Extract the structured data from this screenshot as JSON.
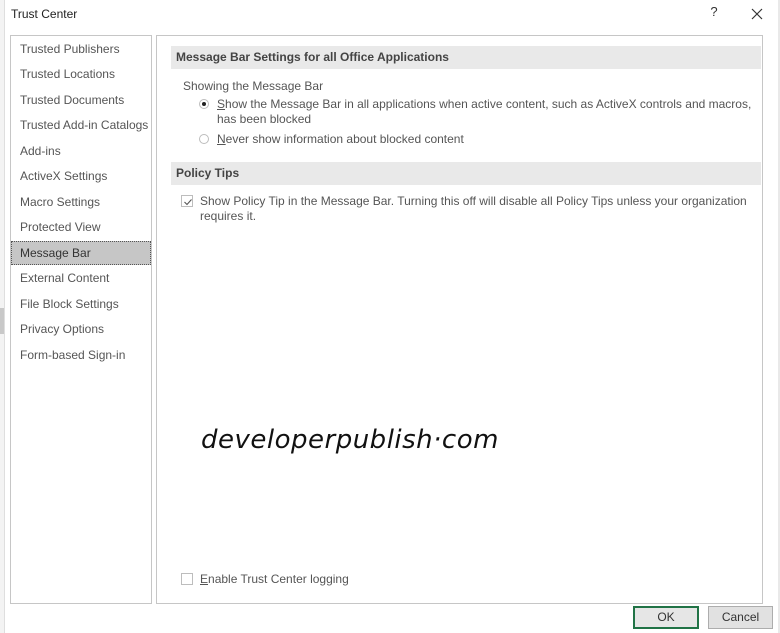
{
  "window": {
    "title": "Trust Center",
    "help_label": "?",
    "close_icon": "close-icon"
  },
  "sidebar": {
    "items": [
      {
        "label": "Trusted Publishers",
        "selected": false
      },
      {
        "label": "Trusted Locations",
        "selected": false
      },
      {
        "label": "Trusted Documents",
        "selected": false
      },
      {
        "label": "Trusted Add-in Catalogs",
        "selected": false
      },
      {
        "label": "Add-ins",
        "selected": false
      },
      {
        "label": "ActiveX Settings",
        "selected": false
      },
      {
        "label": "Macro Settings",
        "selected": false
      },
      {
        "label": "Protected View",
        "selected": false
      },
      {
        "label": "Message Bar",
        "selected": true
      },
      {
        "label": "External Content",
        "selected": false
      },
      {
        "label": "File Block Settings",
        "selected": false
      },
      {
        "label": "Privacy Options",
        "selected": false
      },
      {
        "label": "Form-based Sign-in",
        "selected": false
      }
    ]
  },
  "main": {
    "message_bar_section": {
      "header": "Message Bar Settings for all Office Applications",
      "group_label": "Showing the Message Bar",
      "options": [
        {
          "accel": "S",
          "rest": "how the Message Bar in all applications when active content, such as ActiveX controls and macros, has been blocked",
          "checked": true
        },
        {
          "accel": "N",
          "rest": "ever show information about blocked content",
          "checked": false
        }
      ]
    },
    "policy_tips_section": {
      "header": "Policy Tips",
      "checkbox": {
        "label": "Show Policy Tip in the Message Bar. Turning this off will disable all Policy Tips unless your organization requires it.",
        "checked": true
      }
    },
    "watermark": "developerpublish·com",
    "logging": {
      "accel": "E",
      "rest": "nable Trust Center logging",
      "checked": false
    }
  },
  "footer": {
    "ok_label": "OK",
    "cancel_label": "Cancel"
  },
  "colors": {
    "ok_border": "#217346",
    "selected_bg": "#c6c6c6",
    "section_header_bg": "#e9e9e9"
  }
}
